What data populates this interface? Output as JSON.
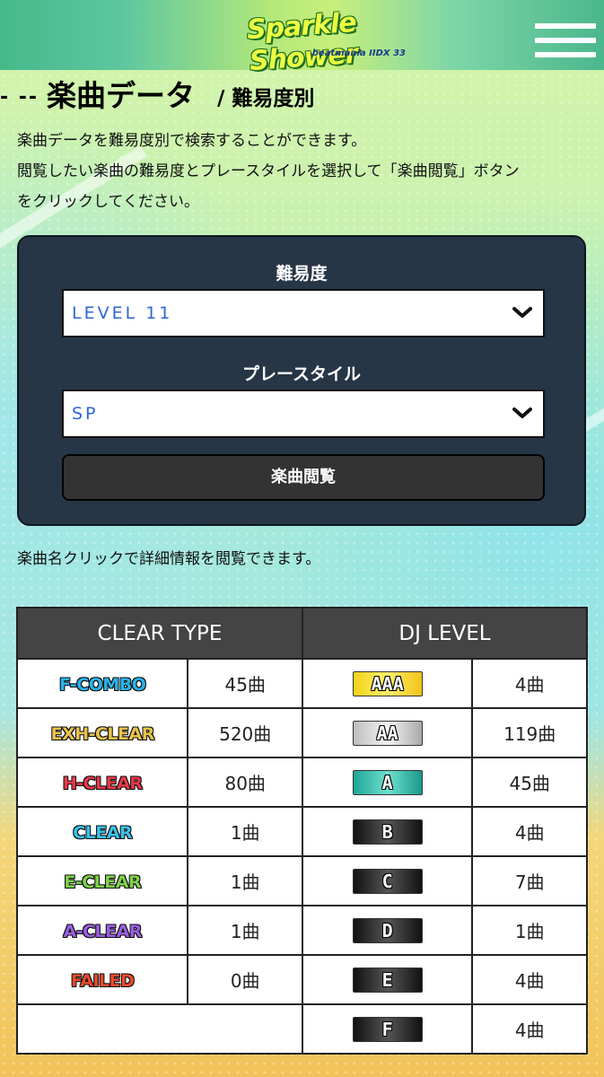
{
  "header": {
    "logo_main": "Sparkle Shower",
    "logo_sub": "beatmania IIDX 33",
    "menu_icon": "hamburger-menu-icon"
  },
  "title": {
    "dashes": "- --",
    "main": "楽曲データ",
    "sub": "/ 難易度別"
  },
  "intro": {
    "line1": "楽曲データを難易度別で検索することができます。",
    "line2": "閲覧したい楽曲の難易度とプレースタイルを選択して「楽曲閲覧」ボタン",
    "line3": "をクリックしてください。"
  },
  "search": {
    "difficulty_label": "難易度",
    "difficulty_value": "LEVEL 11",
    "style_label": "プレースタイル",
    "style_value": "SP",
    "submit_label": "楽曲閲覧",
    "chevron_icon": "chevron-down-icon"
  },
  "note": "楽曲名クリックで詳細情報を閲覧できます。",
  "table": {
    "headers": {
      "clear_type": "CLEAR TYPE",
      "dj_level": "DJ LEVEL"
    },
    "clear_rows": [
      {
        "label": "F-COMBO",
        "count": "45曲",
        "color": "#29b3ea"
      },
      {
        "label": "EXH-CLEAR",
        "count": "520曲",
        "color": "#e8c24e"
      },
      {
        "label": "H-CLEAR",
        "count": "80曲",
        "color": "#e8384a"
      },
      {
        "label": "CLEAR",
        "count": "1曲",
        "color": "#38c2e8"
      },
      {
        "label": "E-CLEAR",
        "count": "1曲",
        "color": "#7fd24c"
      },
      {
        "label": "A-CLEAR",
        "count": "1曲",
        "color": "#9a5ee0"
      },
      {
        "label": "FAILED",
        "count": "0曲",
        "color": "#e84a2e"
      }
    ],
    "dj_rows": [
      {
        "label": "AAA",
        "count": "4曲",
        "bg": "linear-gradient(90deg,#f3d21a,#fff06a,#f3c21a)"
      },
      {
        "label": "AA",
        "count": "119曲",
        "bg": "linear-gradient(90deg,#bdbdbd,#f4f4f4,#a9a9a9)"
      },
      {
        "label": "A",
        "count": "45曲",
        "bg": "linear-gradient(90deg,#1fa596,#6ee0cf,#1b9a8c)"
      },
      {
        "label": "B",
        "count": "4曲",
        "bg": "linear-gradient(90deg,#111,#555,#111)"
      },
      {
        "label": "C",
        "count": "7曲",
        "bg": "linear-gradient(90deg,#111,#555,#111)"
      },
      {
        "label": "D",
        "count": "1曲",
        "bg": "linear-gradient(90deg,#111,#555,#111)"
      },
      {
        "label": "E",
        "count": "4曲",
        "bg": "linear-gradient(90deg,#111,#555,#111)"
      },
      {
        "label": "F",
        "count": "4曲",
        "bg": "linear-gradient(90deg,#111,#555,#111)"
      }
    ]
  }
}
